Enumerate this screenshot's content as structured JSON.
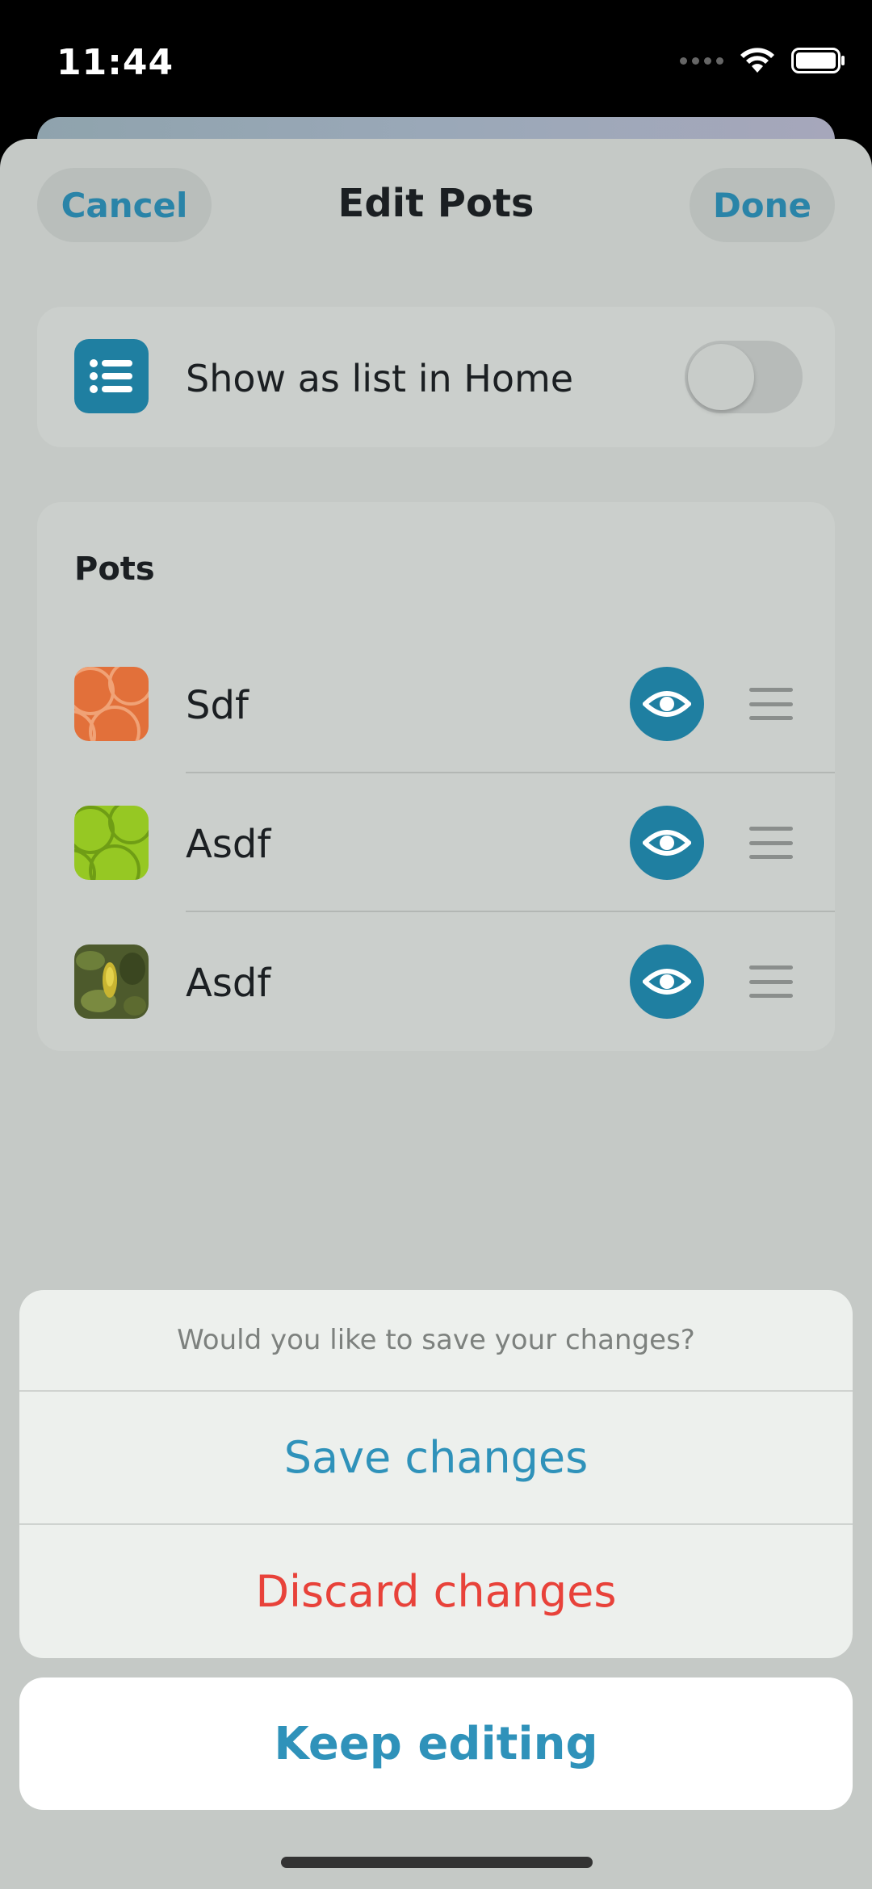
{
  "status_bar": {
    "time": "11:44"
  },
  "header": {
    "cancel_label": "Cancel",
    "title": "Edit Pots",
    "done_label": "Done"
  },
  "settings": {
    "show_as_list_label": "Show as list in Home",
    "show_as_list_enabled": false
  },
  "pots": {
    "header": "Pots",
    "items": [
      {
        "name": "Sdf",
        "visible": true
      },
      {
        "name": "Asdf",
        "visible": true
      },
      {
        "name": "Asdf",
        "visible": true
      }
    ]
  },
  "action_sheet": {
    "message": "Would you like to save your changes?",
    "save_label": "Save changes",
    "discard_label": "Discard changes",
    "keep_editing_label": "Keep editing"
  },
  "colors": {
    "accent": "#1f7fa1",
    "destructive": "#e8423a"
  }
}
